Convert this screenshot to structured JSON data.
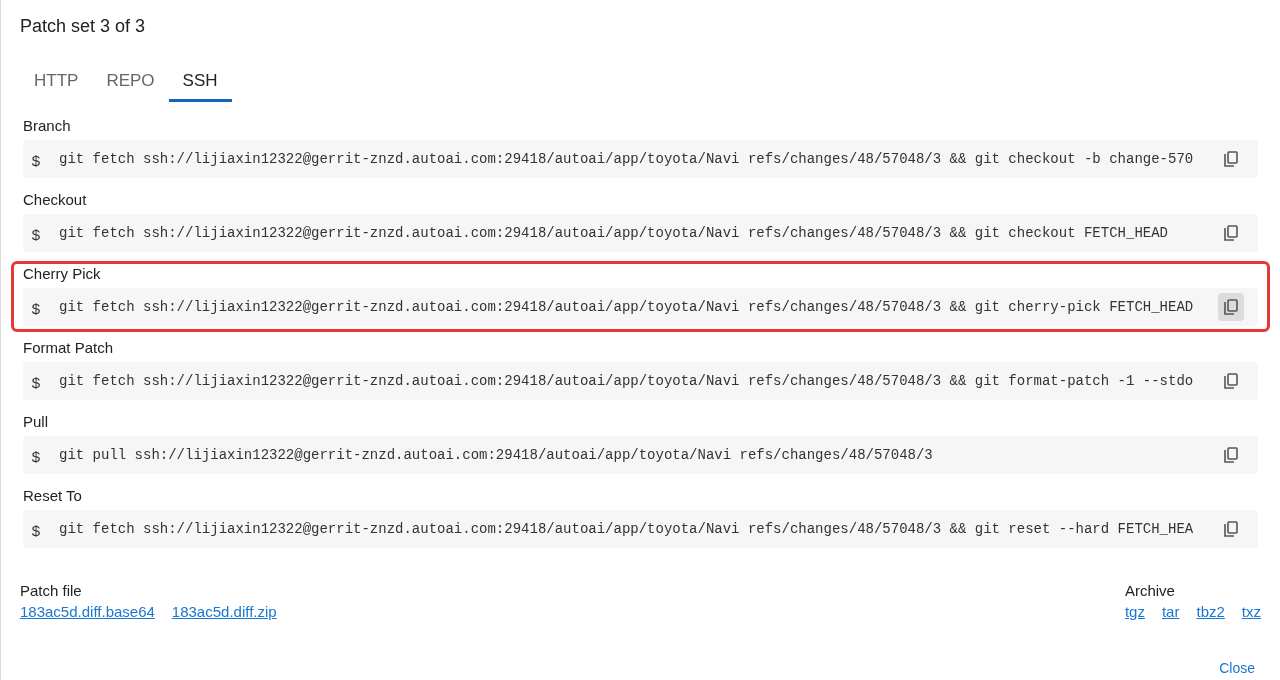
{
  "title": "Patch set 3 of 3",
  "tabs": [
    {
      "label": "HTTP",
      "selected": false
    },
    {
      "label": "REPO",
      "selected": false
    },
    {
      "label": "SSH",
      "selected": true
    }
  ],
  "commands": [
    {
      "label": "Branch",
      "prompt": "$",
      "command": "git fetch ssh://lijiaxin12322@gerrit-znzd.autoai.com:29418/autoai/app/toyota/Navi refs/changes/48/57048/3 && git checkout -b change-570",
      "highlighted": false
    },
    {
      "label": "Checkout",
      "prompt": "$",
      "command": "git fetch ssh://lijiaxin12322@gerrit-znzd.autoai.com:29418/autoai/app/toyota/Navi refs/changes/48/57048/3 && git checkout FETCH_HEAD",
      "highlighted": false
    },
    {
      "label": "Cherry Pick",
      "prompt": "$",
      "command": "git fetch ssh://lijiaxin12322@gerrit-znzd.autoai.com:29418/autoai/app/toyota/Navi refs/changes/48/57048/3 && git cherry-pick FETCH_HEAD",
      "highlighted": true
    },
    {
      "label": "Format Patch",
      "prompt": "$",
      "command": "git fetch ssh://lijiaxin12322@gerrit-znzd.autoai.com:29418/autoai/app/toyota/Navi refs/changes/48/57048/3 && git format-patch -1 --stdo",
      "highlighted": false
    },
    {
      "label": "Pull",
      "prompt": "$",
      "command": "git pull ssh://lijiaxin12322@gerrit-znzd.autoai.com:29418/autoai/app/toyota/Navi refs/changes/48/57048/3",
      "highlighted": false
    },
    {
      "label": "Reset To",
      "prompt": "$",
      "command": "git fetch ssh://lijiaxin12322@gerrit-znzd.autoai.com:29418/autoai/app/toyota/Navi refs/changes/48/57048/3 && git reset --hard FETCH_HEA",
      "highlighted": false
    }
  ],
  "patch_file": {
    "label": "Patch file",
    "links": [
      "183ac5d.diff.base64",
      "183ac5d.diff.zip"
    ]
  },
  "archive": {
    "label": "Archive",
    "links": [
      "tgz",
      "tar",
      "tbz2",
      "txz"
    ]
  },
  "close_button": "Close"
}
